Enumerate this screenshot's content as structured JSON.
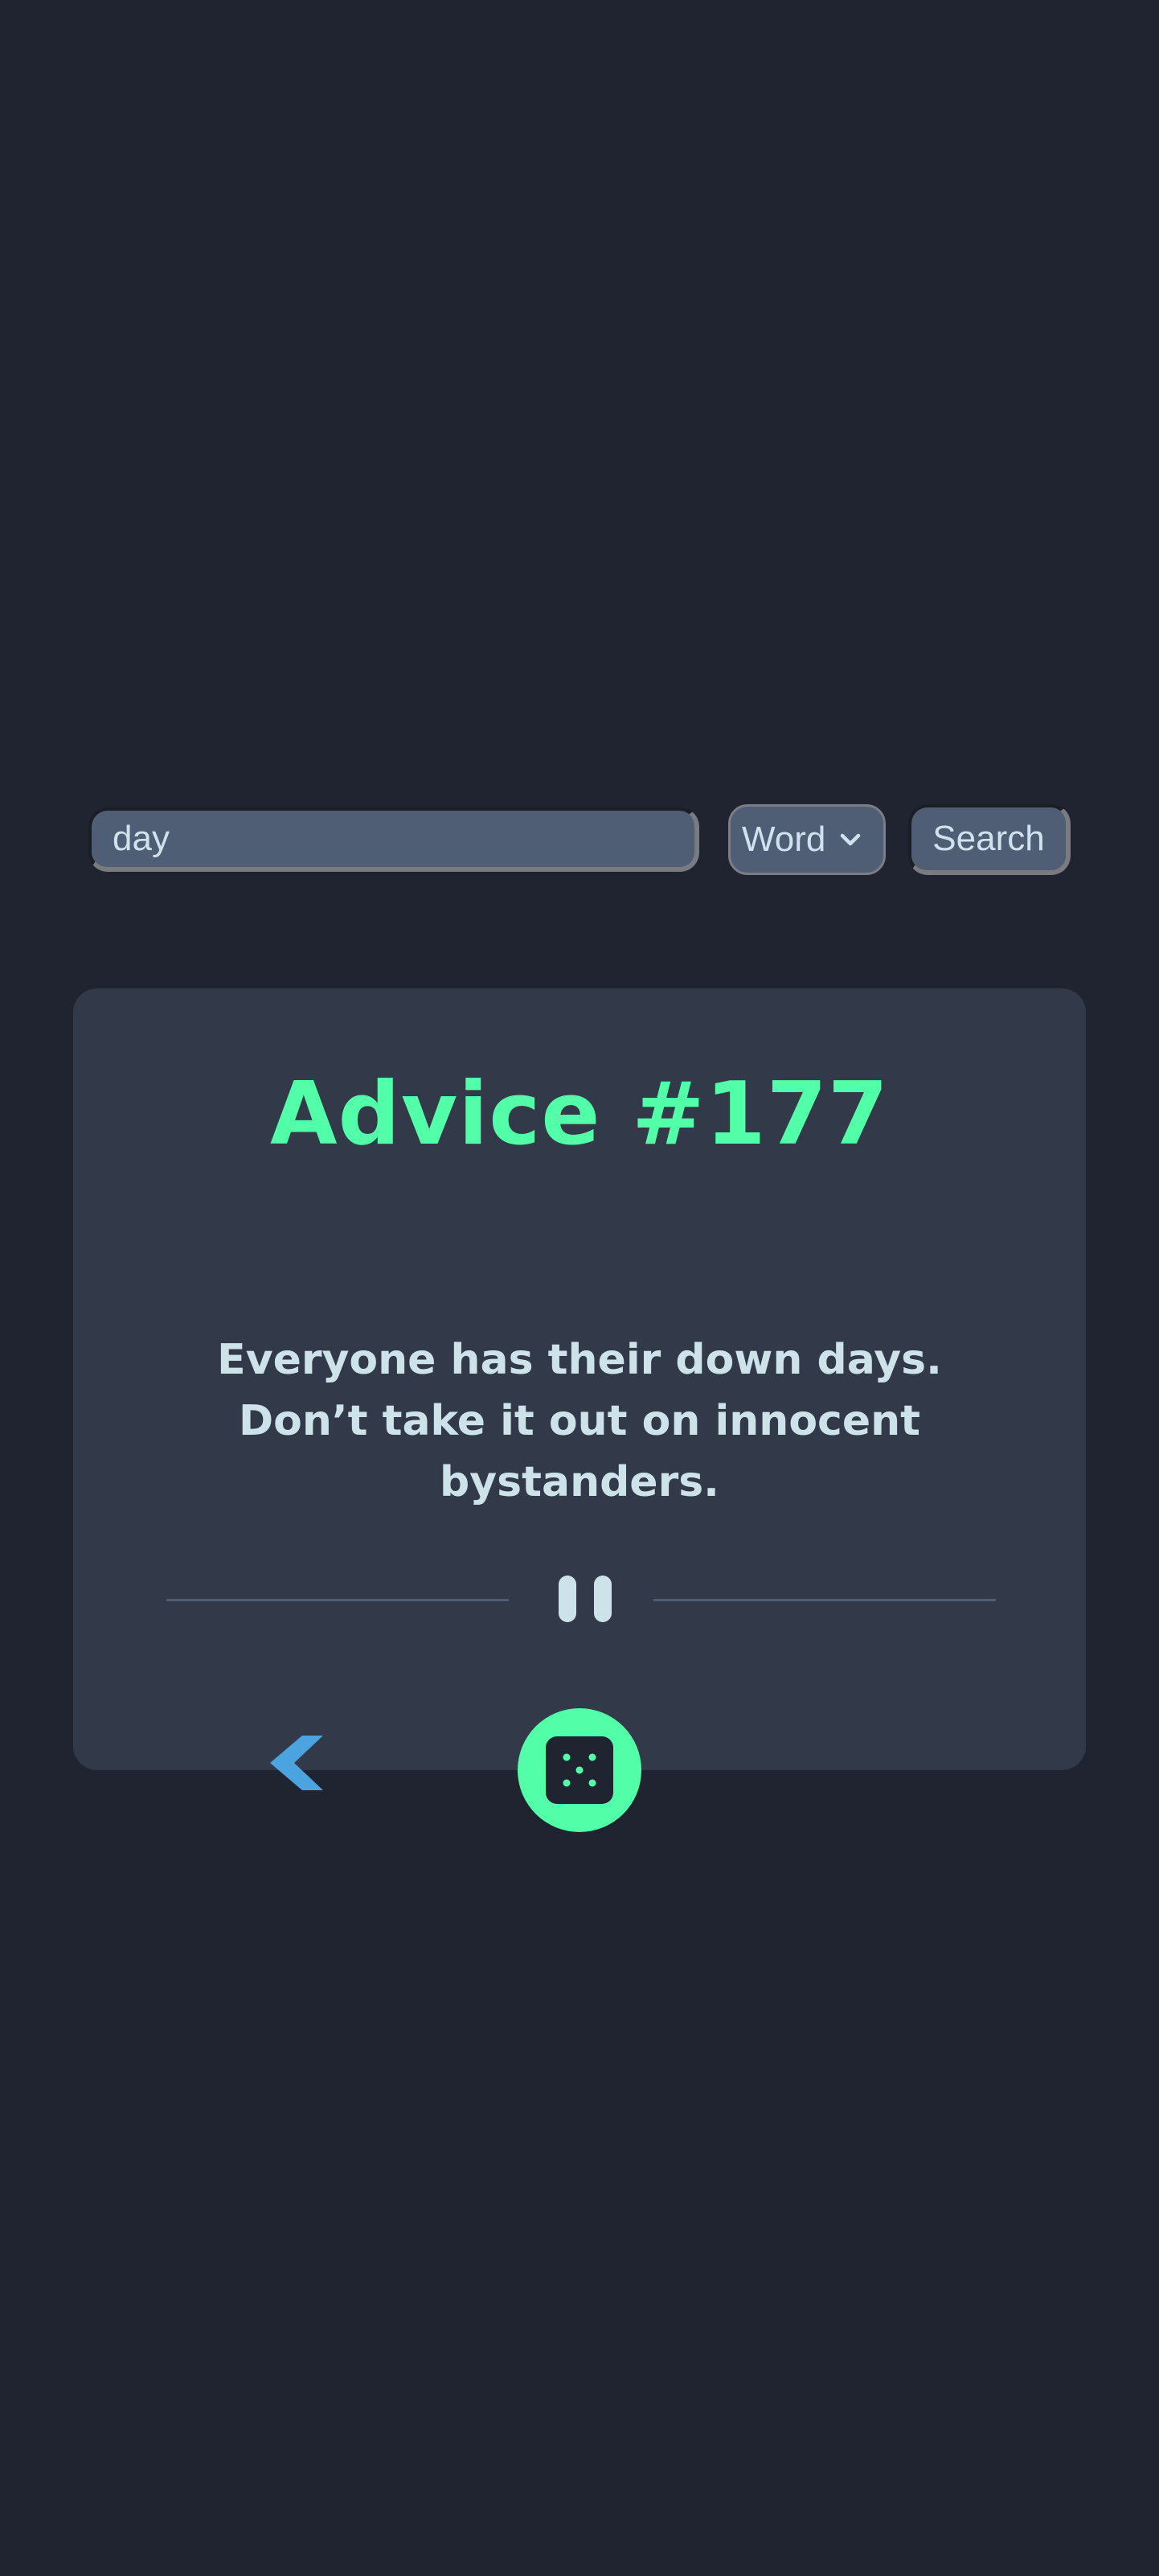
{
  "search": {
    "query": "day",
    "mode_selected": "Word",
    "button_label": "Search"
  },
  "advice": {
    "title": "Advice #177",
    "text": "Everyone has their down days. Don’t take it out on innocent bystanders."
  },
  "icons": {
    "mode_dropdown": "chevron-down-icon",
    "divider": "pause-icon",
    "previous": "chevron-left-icon",
    "random": "dice-icon"
  },
  "colors": {
    "background": "#202430",
    "card": "#323a4a",
    "accent": "#52ffa8",
    "text": "#cee3e9",
    "input": "#4f5d75",
    "previous_arrow": "#4ba3e0"
  }
}
